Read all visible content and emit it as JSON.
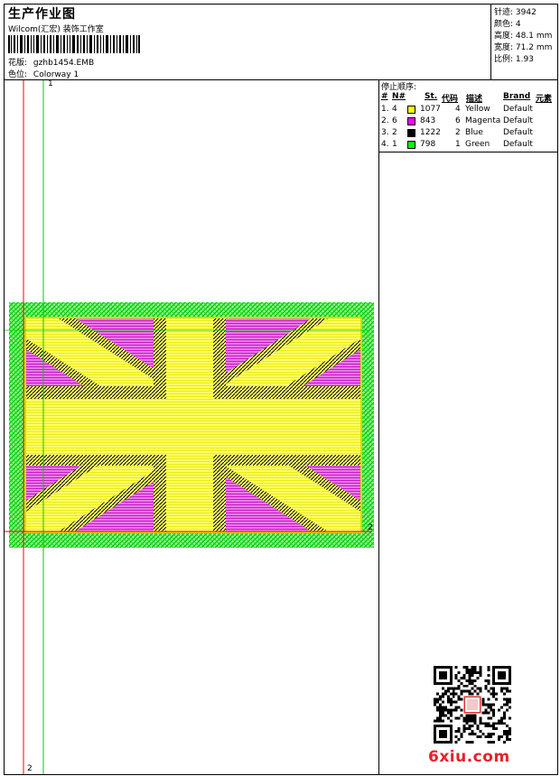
{
  "header": {
    "title": "生产作业图",
    "subtitle": "Wilcom(汇宏) 装饰工作室",
    "design_label": "花版:",
    "design_file": "gzhb1454.EMB",
    "colorway_label": "色位:",
    "colorway": "Colorway 1"
  },
  "stats": [
    {
      "label": "针迹:",
      "value": "3942"
    },
    {
      "label": "颜色:",
      "value": "4"
    },
    {
      "label": "高度:",
      "value": "48.1 mm"
    },
    {
      "label": "宽度:",
      "value": "71.2 mm"
    },
    {
      "label": "比例:",
      "value": "1.93"
    }
  ],
  "stop_sequence": {
    "title": "停止顺序:",
    "columns": [
      "#",
      "N#",
      "St.",
      "代码",
      "描述",
      "Brand",
      "元素"
    ],
    "rows": [
      {
        "idx": "1.",
        "n": "4",
        "color": "#ffff00",
        "st": "1077",
        "code": "4",
        "desc": "Yellow",
        "brand": "Default"
      },
      {
        "idx": "2.",
        "n": "6",
        "color": "#ff00ff",
        "st": "843",
        "code": "6",
        "desc": "Magenta",
        "brand": "Default"
      },
      {
        "idx": "3.",
        "n": "2",
        "color": "#000000",
        "st": "1222",
        "code": "2",
        "desc": "Blue",
        "brand": "Default"
      },
      {
        "idx": "4.",
        "n": "1",
        "color": "#00ff00",
        "st": "798",
        "code": "1",
        "desc": "Green",
        "brand": "Default"
      }
    ]
  },
  "axes": {
    "vertical_top": "1",
    "vertical_bottom": "2",
    "horizontal_right": "2"
  },
  "watermark": "6xiu.com"
}
